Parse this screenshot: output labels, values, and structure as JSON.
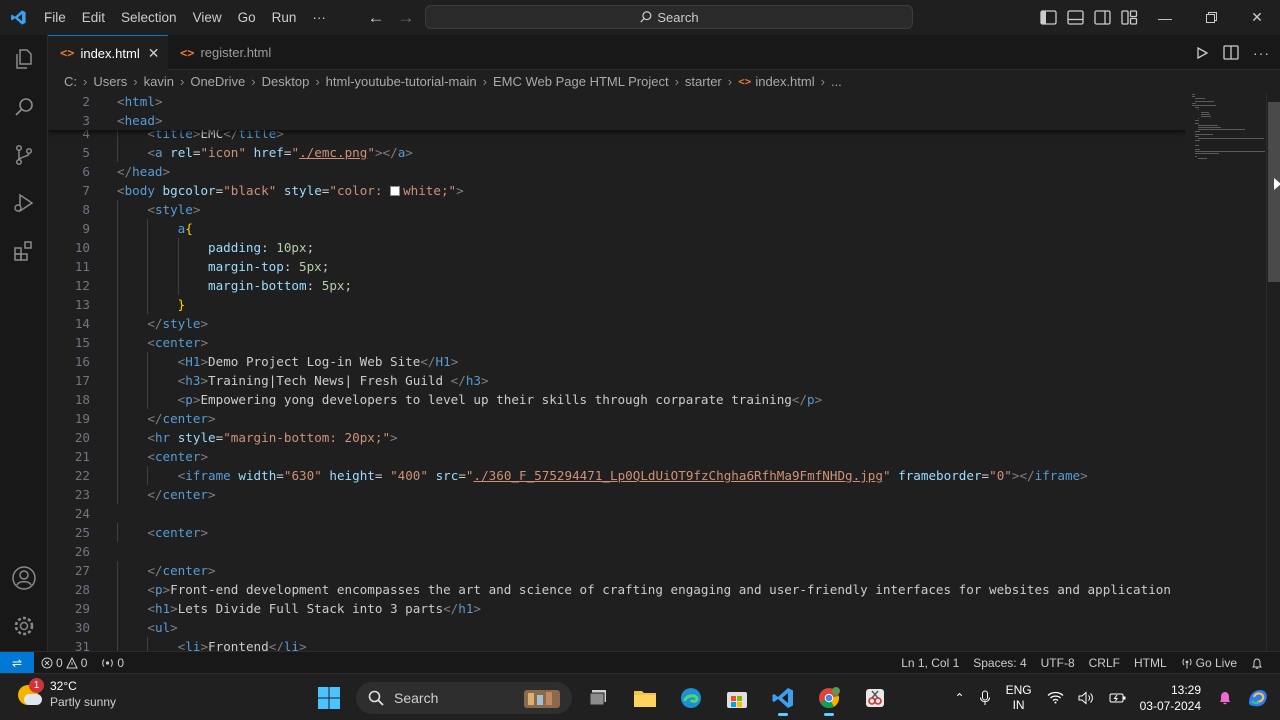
{
  "titlebar": {
    "menu": [
      "File",
      "Edit",
      "Selection",
      "View",
      "Go",
      "Run",
      "···"
    ],
    "search": "Search"
  },
  "tabs": [
    {
      "label": "index.html",
      "icon": "html-file-icon"
    },
    {
      "label": "register.html",
      "icon": "html-file-icon"
    }
  ],
  "breadcrumb": [
    "C:",
    "Users",
    "kavin",
    "OneDrive",
    "Desktop",
    "html-youtube-tutorial-main",
    "EMC Web Page HTML Project",
    "starter",
    "index.html",
    "..."
  ],
  "editor": {
    "sticky": [
      {
        "num": "2",
        "tokens": [
          [
            "b",
            "<"
          ],
          [
            "t",
            "html"
          ],
          [
            "b",
            ">"
          ]
        ]
      },
      {
        "num": "3",
        "tokens": [
          [
            "b",
            "<"
          ],
          [
            "t",
            "head"
          ],
          [
            "b",
            ">"
          ]
        ]
      }
    ],
    "lines": [
      {
        "num": "4",
        "indent": 1,
        "tokens": [
          [
            "b",
            "<"
          ],
          [
            "t",
            "title"
          ],
          [
            "b",
            ">"
          ],
          [
            "p",
            "EMC"
          ],
          [
            "b",
            "</"
          ],
          [
            "t",
            "title"
          ],
          [
            "b",
            ">"
          ]
        ]
      },
      {
        "num": "5",
        "indent": 1,
        "tokens": [
          [
            "b",
            "<"
          ],
          [
            "t",
            "a"
          ],
          [
            "p",
            " "
          ],
          [
            "a",
            "rel"
          ],
          [
            "p",
            "="
          ],
          [
            "s",
            "\"icon\""
          ],
          [
            "p",
            " "
          ],
          [
            "a",
            "href"
          ],
          [
            "p",
            "="
          ],
          [
            "s",
            "\""
          ],
          [
            "su",
            "./emc.png"
          ],
          [
            "s",
            "\""
          ],
          [
            "b",
            "></"
          ],
          [
            "t",
            "a"
          ],
          [
            "b",
            ">"
          ]
        ]
      },
      {
        "num": "6",
        "indent": 0,
        "tokens": [
          [
            "b",
            "</"
          ],
          [
            "t",
            "head"
          ],
          [
            "b",
            ">"
          ]
        ]
      },
      {
        "num": "7",
        "indent": 0,
        "tokens": [
          [
            "b",
            "<"
          ],
          [
            "t",
            "body"
          ],
          [
            "p",
            " "
          ],
          [
            "a",
            "bgcolor"
          ],
          [
            "p",
            "="
          ],
          [
            "s",
            "\"black\""
          ],
          [
            "p",
            " "
          ],
          [
            "a",
            "style"
          ],
          [
            "p",
            "="
          ],
          [
            "s",
            "\"color: "
          ],
          [
            "box",
            ""
          ],
          [
            "s",
            "white;\""
          ],
          [
            "b",
            ">"
          ]
        ]
      },
      {
        "num": "8",
        "indent": 1,
        "tokens": [
          [
            "b",
            "<"
          ],
          [
            "t",
            "style"
          ],
          [
            "b",
            ">"
          ]
        ]
      },
      {
        "num": "9",
        "indent": 2,
        "tokens": [
          [
            "t",
            "a"
          ],
          [
            "br",
            "{"
          ]
        ]
      },
      {
        "num": "10",
        "indent": 3,
        "tokens": [
          [
            "k",
            "padding"
          ],
          [
            "p",
            ": "
          ],
          [
            "n",
            "10px"
          ],
          [
            "p",
            ";"
          ]
        ]
      },
      {
        "num": "11",
        "indent": 3,
        "tokens": [
          [
            "k",
            "margin-top"
          ],
          [
            "p",
            ": "
          ],
          [
            "n",
            "5px"
          ],
          [
            "p",
            ";"
          ]
        ]
      },
      {
        "num": "12",
        "indent": 3,
        "tokens": [
          [
            "k",
            "margin-bottom"
          ],
          [
            "p",
            ": "
          ],
          [
            "n",
            "5px"
          ],
          [
            "p",
            ";"
          ]
        ]
      },
      {
        "num": "13",
        "indent": 2,
        "tokens": [
          [
            "br",
            "}"
          ]
        ]
      },
      {
        "num": "14",
        "indent": 1,
        "tokens": [
          [
            "b",
            "</"
          ],
          [
            "t",
            "style"
          ],
          [
            "b",
            ">"
          ]
        ]
      },
      {
        "num": "15",
        "indent": 1,
        "tokens": [
          [
            "b",
            "<"
          ],
          [
            "t",
            "center"
          ],
          [
            "b",
            ">"
          ]
        ]
      },
      {
        "num": "16",
        "indent": 2,
        "tokens": [
          [
            "b",
            "<"
          ],
          [
            "t",
            "H1"
          ],
          [
            "b",
            ">"
          ],
          [
            "p",
            "Demo Project Log-in Web Site"
          ],
          [
            "b",
            "</"
          ],
          [
            "t",
            "H1"
          ],
          [
            "b",
            ">"
          ]
        ]
      },
      {
        "num": "17",
        "indent": 2,
        "tokens": [
          [
            "b",
            "<"
          ],
          [
            "t",
            "h3"
          ],
          [
            "b",
            ">"
          ],
          [
            "p",
            "Training|Tech News| Fresh Guild "
          ],
          [
            "b",
            "</"
          ],
          [
            "t",
            "h3"
          ],
          [
            "b",
            ">"
          ]
        ]
      },
      {
        "num": "18",
        "indent": 2,
        "tokens": [
          [
            "b",
            "<"
          ],
          [
            "t",
            "p"
          ],
          [
            "b",
            ">"
          ],
          [
            "p",
            "Empowering yong developers to level up their skills through corparate training"
          ],
          [
            "b",
            "</"
          ],
          [
            "t",
            "p"
          ],
          [
            "b",
            ">"
          ]
        ]
      },
      {
        "num": "19",
        "indent": 1,
        "tokens": [
          [
            "b",
            "</"
          ],
          [
            "t",
            "center"
          ],
          [
            "b",
            ">"
          ]
        ]
      },
      {
        "num": "20",
        "indent": 1,
        "tokens": [
          [
            "b",
            "<"
          ],
          [
            "t",
            "hr"
          ],
          [
            "p",
            " "
          ],
          [
            "a",
            "style"
          ],
          [
            "p",
            "="
          ],
          [
            "s",
            "\"margin-bottom: 20px;\""
          ],
          [
            "b",
            ">"
          ]
        ]
      },
      {
        "num": "21",
        "indent": 1,
        "tokens": [
          [
            "b",
            "<"
          ],
          [
            "t",
            "center"
          ],
          [
            "b",
            ">"
          ]
        ]
      },
      {
        "num": "22",
        "indent": 2,
        "tokens": [
          [
            "b",
            "<"
          ],
          [
            "t",
            "iframe"
          ],
          [
            "p",
            " "
          ],
          [
            "a",
            "width"
          ],
          [
            "p",
            "="
          ],
          [
            "s",
            "\"630\""
          ],
          [
            "p",
            " "
          ],
          [
            "a",
            "height"
          ],
          [
            "p",
            "= "
          ],
          [
            "s",
            "\"400\""
          ],
          [
            "p",
            " "
          ],
          [
            "a",
            "src"
          ],
          [
            "p",
            "="
          ],
          [
            "s",
            "\""
          ],
          [
            "su",
            "./360_F_575294471_Lp0QLdUiOT9fzChgha6RfhMa9FmfNHDg.jpg"
          ],
          [
            "s",
            "\""
          ],
          [
            "p",
            " "
          ],
          [
            "a",
            "frameborder"
          ],
          [
            "p",
            "="
          ],
          [
            "s",
            "\"0\""
          ],
          [
            "b",
            "></"
          ],
          [
            "t",
            "iframe"
          ],
          [
            "b",
            ">"
          ]
        ]
      },
      {
        "num": "23",
        "indent": 1,
        "tokens": [
          [
            "b",
            "</"
          ],
          [
            "t",
            "center"
          ],
          [
            "b",
            ">"
          ]
        ]
      },
      {
        "num": "24",
        "indent": 0,
        "tokens": []
      },
      {
        "num": "25",
        "indent": 1,
        "tokens": [
          [
            "b",
            "<"
          ],
          [
            "t",
            "center"
          ],
          [
            "b",
            ">"
          ]
        ]
      },
      {
        "num": "26",
        "indent": 0,
        "tokens": []
      },
      {
        "num": "27",
        "indent": 1,
        "tokens": [
          [
            "b",
            "</"
          ],
          [
            "t",
            "center"
          ],
          [
            "b",
            ">"
          ]
        ]
      },
      {
        "num": "28",
        "indent": 1,
        "tokens": [
          [
            "b",
            "<"
          ],
          [
            "t",
            "p"
          ],
          [
            "b",
            ">"
          ],
          [
            "p",
            "Front-end development encompasses the art and science of crafting engaging and user-friendly interfaces for websites and application"
          ]
        ]
      },
      {
        "num": "29",
        "indent": 1,
        "tokens": [
          [
            "b",
            "<"
          ],
          [
            "t",
            "h1"
          ],
          [
            "b",
            ">"
          ],
          [
            "p",
            "Lets Divide Full Stack into 3 parts"
          ],
          [
            "b",
            "</"
          ],
          [
            "t",
            "h1"
          ],
          [
            "b",
            ">"
          ]
        ]
      },
      {
        "num": "30",
        "indent": 1,
        "tokens": [
          [
            "b",
            "<"
          ],
          [
            "t",
            "ul"
          ],
          [
            "b",
            ">"
          ]
        ]
      },
      {
        "num": "31",
        "indent": 2,
        "tokens": [
          [
            "b",
            "<"
          ],
          [
            "t",
            "li"
          ],
          [
            "b",
            ">"
          ],
          [
            "p",
            "Frontend"
          ],
          [
            "b",
            "</"
          ],
          [
            "t",
            "li"
          ],
          [
            "b",
            ">"
          ]
        ]
      }
    ]
  },
  "statusbar": {
    "errors": "0",
    "warnings": "0",
    "ports": "0",
    "position": "Ln 1, Col 1",
    "spaces": "Spaces: 4",
    "encoding": "UTF-8",
    "eol": "CRLF",
    "language": "HTML",
    "golive": "Go Live"
  },
  "taskbar": {
    "weather_temp": "32°C",
    "weather_desc": "Partly sunny",
    "weather_badge": "1",
    "search": "Search",
    "lang_top": "ENG",
    "lang_bottom": "IN",
    "time": "13:29",
    "date": "03-07-2024"
  },
  "colors": {
    "accent": "#0078d4",
    "editor_bg": "#1f1f1f",
    "tag": "#569cd6",
    "attr": "#9cdcfe",
    "string": "#ce9178"
  }
}
